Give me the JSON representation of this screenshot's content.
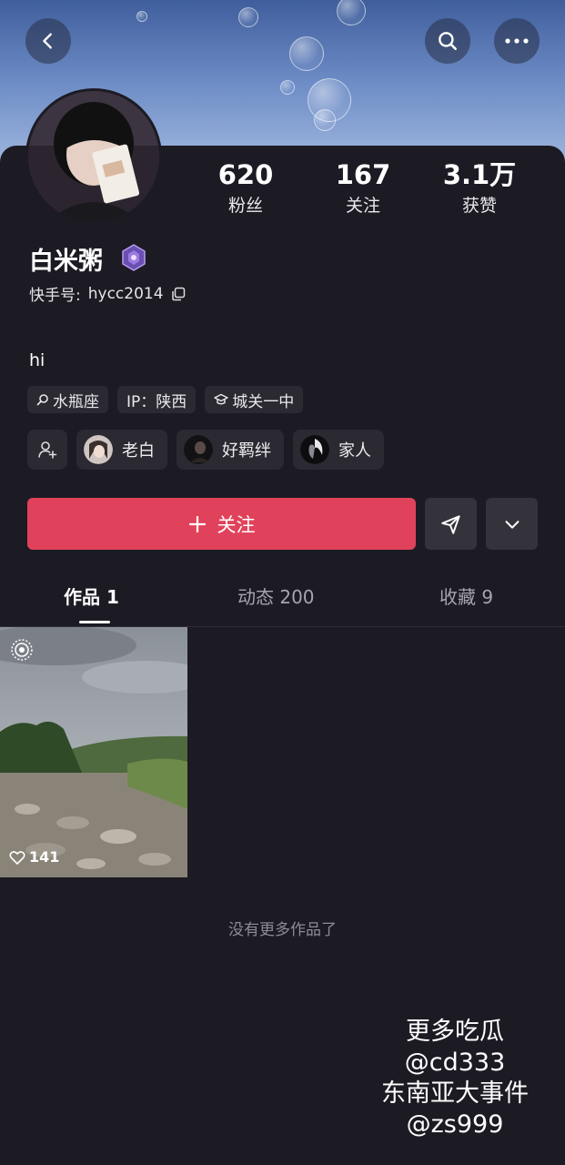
{
  "stats": [
    {
      "value": "620",
      "label": "粉丝"
    },
    {
      "value": "167",
      "label": "关注"
    },
    {
      "value": "3.1万",
      "label": "获赞"
    }
  ],
  "profile": {
    "name": "白米粥",
    "uid_label": "快手号:",
    "uid": "hycc2014",
    "bio": "hi"
  },
  "tags": [
    {
      "icon": "search-icon",
      "label": "水瓶座"
    },
    {
      "icon": "",
      "label": "IP：陕西"
    },
    {
      "icon": "graduation-cap-icon",
      "label": "城关一中"
    }
  ],
  "friends": [
    {
      "label": "老白"
    },
    {
      "label": "好羁绊"
    },
    {
      "label": "家人"
    }
  ],
  "actions": {
    "follow_label": "关注"
  },
  "tabs": [
    {
      "label": "作品 1"
    },
    {
      "label": "动态 200"
    },
    {
      "label": "收藏 9"
    }
  ],
  "post": {
    "likes": "141"
  },
  "empty_text": "没有更多作品了",
  "watermark": [
    "更多吃瓜",
    "@cd333",
    "东南亚大事件",
    "@zs999"
  ],
  "colors": {
    "accent": "#e1425b",
    "background": "#1c1b24",
    "chip": "#2b2a33"
  }
}
